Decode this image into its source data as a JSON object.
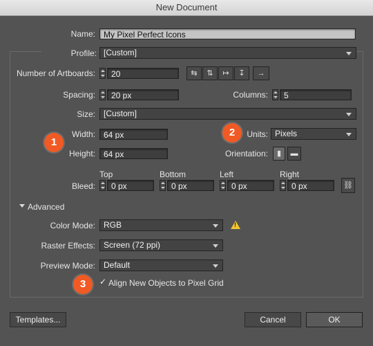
{
  "window": {
    "title": "New Document"
  },
  "name": {
    "label": "Name:",
    "value": "My Pixel Perfect Icons"
  },
  "profile": {
    "label": "Profile:",
    "value": "[Custom]"
  },
  "artboards": {
    "label": "Number of Artboards:",
    "value": "20",
    "arrow_label": "→"
  },
  "spacing": {
    "label": "Spacing:",
    "value": "20 px"
  },
  "columns": {
    "label": "Columns:",
    "value": "5"
  },
  "size": {
    "label": "Size:",
    "value": "[Custom]"
  },
  "width": {
    "label": "Width:",
    "value": "64 px"
  },
  "height": {
    "label": "Height:",
    "value": "64 px"
  },
  "units": {
    "label": "Units:",
    "value": "Pixels"
  },
  "orientation": {
    "label": "Orientation:"
  },
  "bleed": {
    "label": "Bleed:",
    "top": {
      "label": "Top",
      "value": "0 px"
    },
    "bottom": {
      "label": "Bottom",
      "value": "0 px"
    },
    "left": {
      "label": "Left",
      "value": "0 px"
    },
    "right": {
      "label": "Right",
      "value": "0 px"
    }
  },
  "advanced": {
    "label": "Advanced",
    "color_mode": {
      "label": "Color Mode:",
      "value": "RGB"
    },
    "raster_effects": {
      "label": "Raster Effects:",
      "value": "Screen (72 ppi)"
    },
    "preview_mode": {
      "label": "Preview Mode:",
      "value": "Default"
    },
    "align_pixel_grid": {
      "label": "Align New Objects to Pixel Grid",
      "checked": true,
      "check_glyph": "✓"
    }
  },
  "callouts": [
    "1",
    "2",
    "3"
  ],
  "buttons": {
    "templates": "Templates...",
    "cancel": "Cancel",
    "ok": "OK"
  },
  "colors": {
    "callout": "#f15a24",
    "warning": "#f4c430"
  }
}
